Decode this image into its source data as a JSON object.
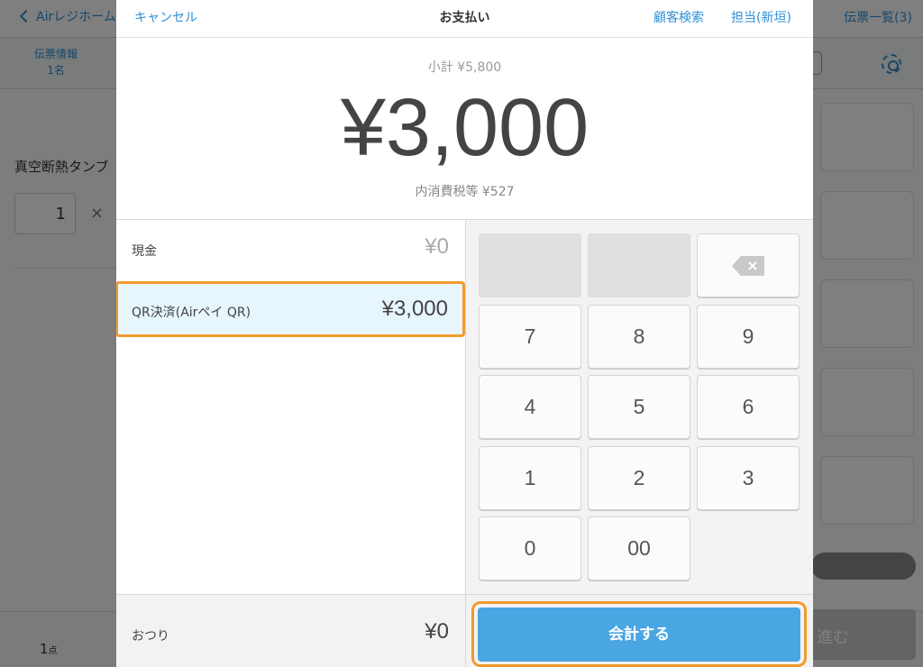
{
  "background": {
    "back_label": "Airレジホーム",
    "slip_list_label": "伝票一覧(3)",
    "slip_info_line1": "伝票情報",
    "slip_info_line2": "1名",
    "item_name": "真空断熱タンブ",
    "item_qty": "1",
    "times_symbol": "×",
    "item_count": "1",
    "item_count_unit": "点",
    "next_label": "進む"
  },
  "modal": {
    "cancel_label": "キャンセル",
    "title": "お支払い",
    "customer_search_label": "顧客検索",
    "staff_label": "担当(新垣)",
    "subtotal": "小計 ¥5,800",
    "amount": "¥3,000",
    "tax": "内消費税等 ¥527",
    "methods": [
      {
        "label": "現金",
        "value": "¥0"
      },
      {
        "label": "QR決済(Airペイ QR)",
        "value": "¥3,000",
        "selected": true
      }
    ],
    "change_label": "おつり",
    "change_value": "¥0",
    "checkout_label": "会計する"
  },
  "keypad": {
    "keys": [
      "7",
      "8",
      "9",
      "4",
      "5",
      "6",
      "1",
      "2",
      "3",
      "0",
      "00"
    ],
    "backspace_icon": "backspace-icon"
  },
  "colors": {
    "accent": "#2d8fd5",
    "checkout": "#4aa6e2",
    "highlight": "#f29a2e",
    "selected_row": "#e7f5fd"
  }
}
